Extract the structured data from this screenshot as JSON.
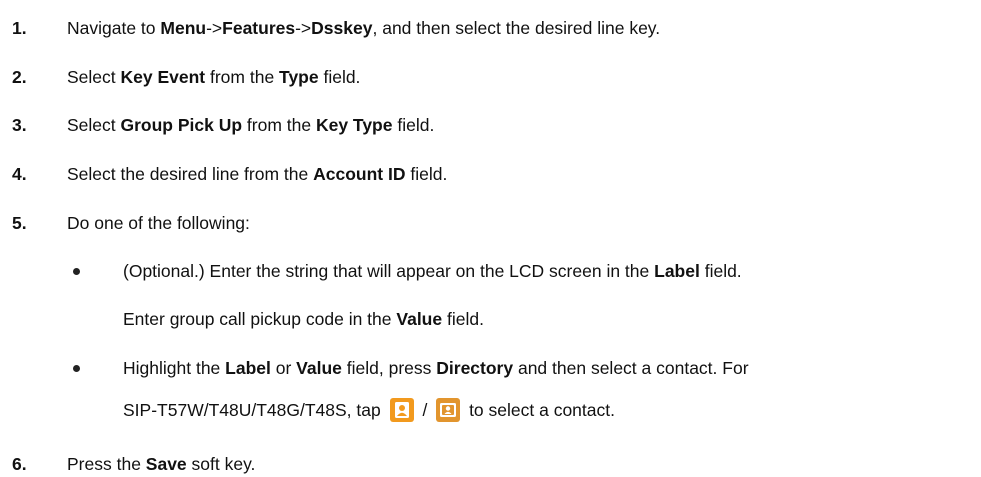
{
  "steps": [
    {
      "num": "1.",
      "parts": {
        "a": "Navigate to ",
        "b": "Menu",
        "c": "->",
        "d": "Features",
        "e": "->",
        "f": "Dsskey",
        "g": ", and then select the desired line key."
      }
    },
    {
      "num": "2.",
      "parts": {
        "a": "Select ",
        "b": "Key Event",
        "c": " from the ",
        "d": "Type",
        "e": " field."
      }
    },
    {
      "num": "3.",
      "parts": {
        "a": "Select ",
        "b": "Group Pick Up",
        "c": " from the ",
        "d": "Key Type",
        "e": " field."
      }
    },
    {
      "num": "4.",
      "parts": {
        "a": "Select the desired line from the ",
        "b": "Account ID",
        "c": " field."
      }
    },
    {
      "num": "5.",
      "parts": {
        "a": "Do one of the following:"
      }
    },
    {
      "num": "6.",
      "parts": {
        "a": "Press the ",
        "b": "Save",
        "c": " soft key."
      }
    }
  ],
  "bullets": [
    {
      "line1": {
        "a": "(Optional.) Enter the string that will appear on the LCD screen in the ",
        "b": "Label",
        "c": " field."
      },
      "line2": {
        "a": "Enter group call pickup code in the ",
        "b": "Value",
        "c": " field."
      }
    },
    {
      "line1": {
        "a": "Highlight the ",
        "b": "Label",
        "c": " or ",
        "d": "Value",
        "e": " field, press ",
        "f": "Directory",
        "g": " and then select a contact. For"
      },
      "line2": {
        "a": "SIP-T57W/T48U/T48G/T48S, tap ",
        "sep": " / ",
        "b": " to select a contact."
      }
    }
  ],
  "icons": {
    "contact_icon_1": {
      "name": "contact-person-icon",
      "color": "#F29A1E"
    },
    "contact_icon_2": {
      "name": "contact-card-icon",
      "color": "#E2952E"
    }
  }
}
